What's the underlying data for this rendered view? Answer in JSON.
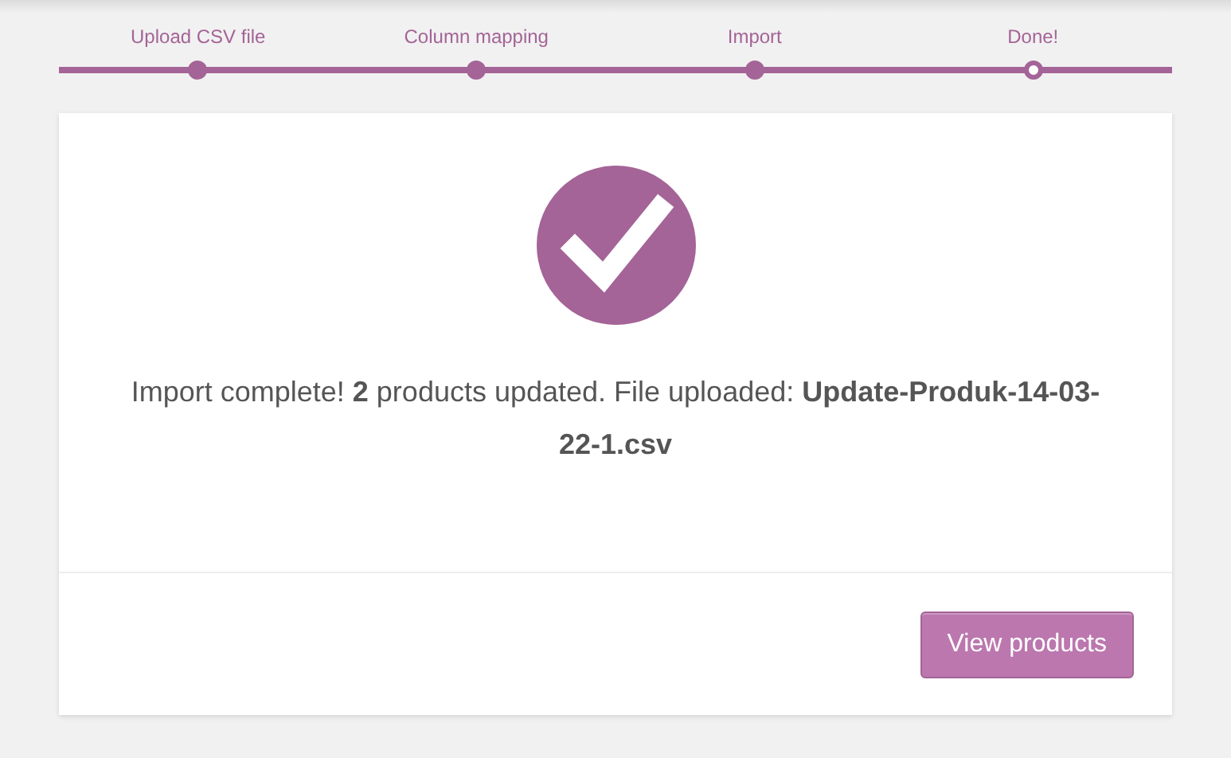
{
  "steps": [
    {
      "label": "Upload CSV file",
      "selected": false
    },
    {
      "label": "Column mapping",
      "selected": false
    },
    {
      "label": "Import",
      "selected": false
    },
    {
      "label": "Done!",
      "selected": true
    }
  ],
  "message": "Import complete! **2** products updated. File uploaded: **Update-Produk-14-03-22-1.csv**",
  "buttons": [
    "View products"
  ]
}
